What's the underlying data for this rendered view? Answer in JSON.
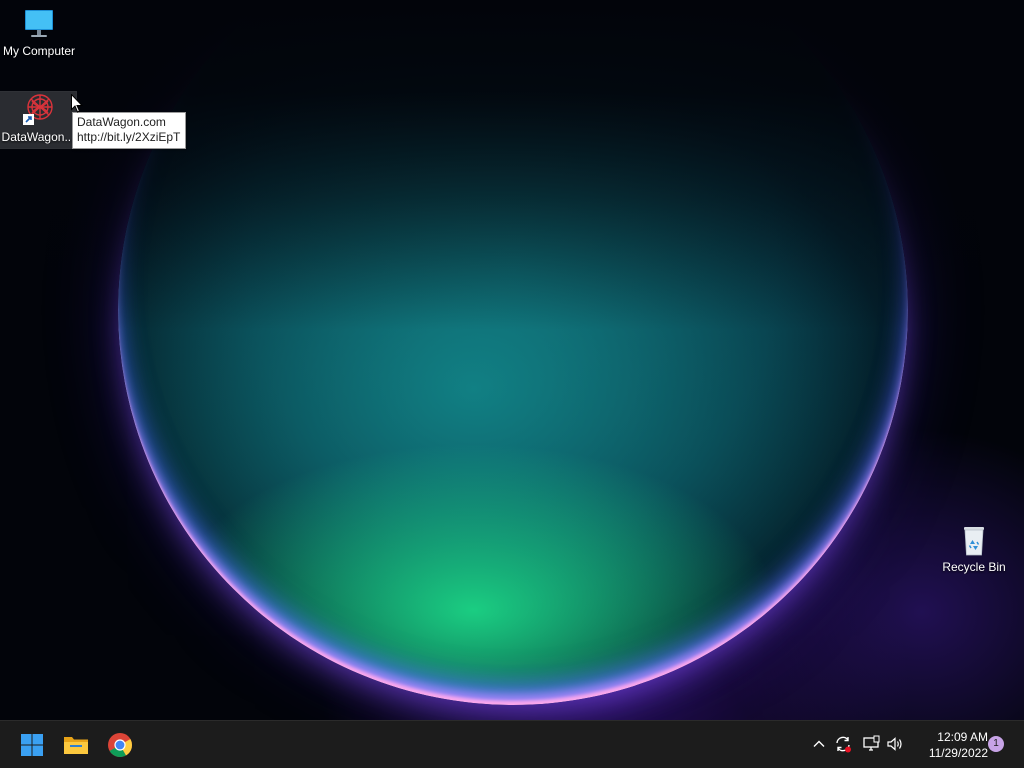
{
  "desktop": {
    "icons": [
      {
        "label": "My Computer"
      },
      {
        "label": "DataWagon..."
      },
      {
        "label": "Recycle Bin"
      }
    ],
    "tooltip": {
      "line1": "DataWagon.com",
      "line2": "http://bit.ly/2XziEpT"
    }
  },
  "taskbar": {
    "pinned": [
      {
        "icon": "windows-start-icon"
      },
      {
        "icon": "file-explorer-icon"
      },
      {
        "icon": "chrome-icon"
      }
    ],
    "tray": {
      "icons": [
        "chevron-up-icon",
        "sync-icon",
        "network-icon",
        "volume-icon"
      ],
      "time": "12:09 AM",
      "date": "11/29/2022",
      "notification_count": "1"
    }
  },
  "colors": {
    "taskbar": "#1c1c1c",
    "start_blue": "#3aa0f2",
    "badge": "#c7a3e6"
  }
}
